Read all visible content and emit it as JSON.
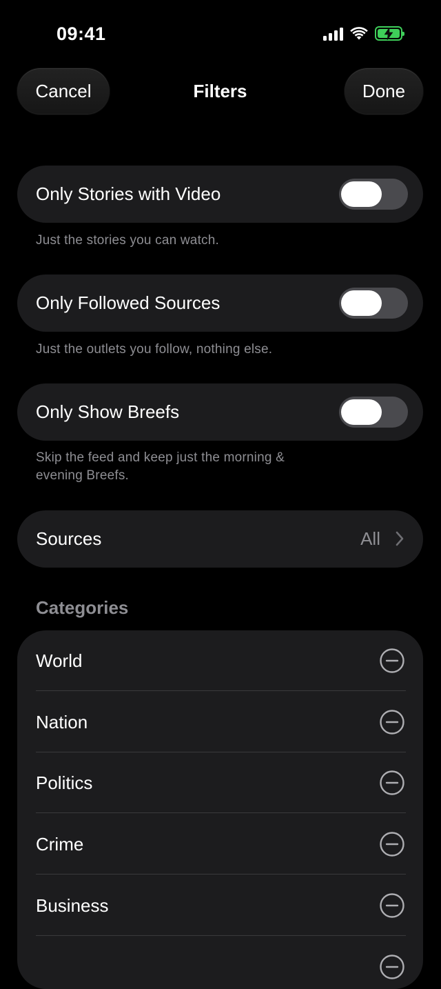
{
  "status_bar": {
    "time": "09:41",
    "battery_color": "#3fcf5a"
  },
  "nav": {
    "cancel_label": "Cancel",
    "title": "Filters",
    "done_label": "Done"
  },
  "toggles": [
    {
      "label": "Only Stories with Video",
      "caption": "Just the stories you can watch.",
      "on": false
    },
    {
      "label": "Only Followed Sources",
      "caption": "Just the outlets you follow, nothing else.",
      "on": false
    },
    {
      "label": "Only Show Breefs",
      "caption": "Skip the feed and keep just the morning & evening Breefs.",
      "on": false
    }
  ],
  "sources": {
    "label": "Sources",
    "value": "All",
    "icon": "chevron-right-icon"
  },
  "categories": {
    "header": "Categories",
    "items": [
      {
        "label": "World",
        "icon": "minus-circle-icon"
      },
      {
        "label": "Nation",
        "icon": "minus-circle-icon"
      },
      {
        "label": "Politics",
        "icon": "minus-circle-icon"
      },
      {
        "label": "Crime",
        "icon": "minus-circle-icon"
      },
      {
        "label": "Business",
        "icon": "minus-circle-icon"
      }
    ]
  },
  "colors": {
    "background": "#000000",
    "card": "#1c1c1e",
    "secondary_text": "#8e8e93",
    "toggle_off_track": "#4a4a4e"
  }
}
